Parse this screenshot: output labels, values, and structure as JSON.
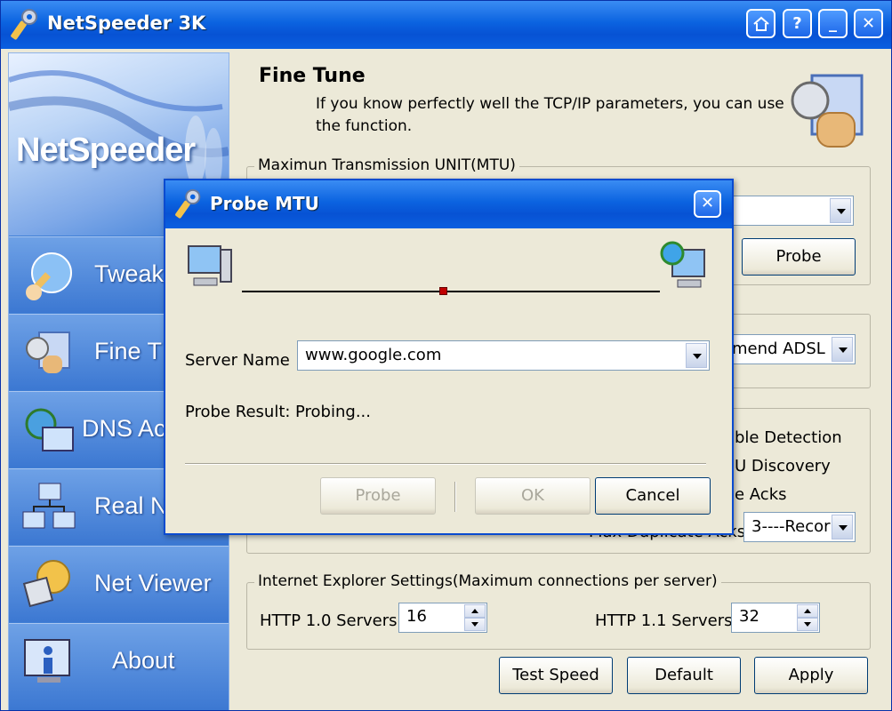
{
  "app": {
    "title": "NetSpeeder 3K",
    "title_buttons": [
      "home-icon",
      "help-icon",
      "minimize-icon",
      "close-icon"
    ]
  },
  "sidebar": {
    "logo_text": "NetSpeeder",
    "items": [
      {
        "label": "Tweak W",
        "icon": "tweak-wizard-icon"
      },
      {
        "label": "Fine T",
        "icon": "fine-tune-icon"
      },
      {
        "label": "DNS Acce",
        "icon": "dns-accelerator-icon"
      },
      {
        "label": "Real N",
        "icon": "network-icon"
      },
      {
        "label": "Net Viewer",
        "icon": "net-viewer-icon"
      },
      {
        "label": "About",
        "icon": "info-icon"
      }
    ]
  },
  "main": {
    "heading": "Fine Tune",
    "description": "If you know perfectly well the TCP/IP parameters, you can use the function.",
    "mtu_group": {
      "label": "Maximun Transmission UNIT(MTU)",
      "probe_button": "Probe"
    },
    "connection_combo": "mend ADSL",
    "options": {
      "opt1": "ble Detection",
      "opt2": "U Discovery",
      "opt3": "e Acks",
      "max_dup_label": "Max Duplicate Acks",
      "max_dup_value": "3----Recor"
    },
    "ie_group": {
      "label": "Internet Explorer Settings(Maximum connections per server)",
      "http10_label": "HTTP 1.0 Servers",
      "http10_value": "16",
      "http11_label": "HTTP 1.1 Servers",
      "http11_value": "32"
    },
    "buttons": {
      "test_speed": "Test Speed",
      "default": "Default",
      "apply": "Apply"
    }
  },
  "dialog": {
    "title": "Probe MTU",
    "progress": 0.48,
    "server_name_label": "Server Name",
    "server_name_value": "www.google.com",
    "probe_result_label": "Probe Result:",
    "probe_result_value": "Probing...",
    "buttons": {
      "probe": "Probe",
      "ok": "OK",
      "cancel": "Cancel"
    }
  },
  "colors": {
    "titlebar": "#0b63e0",
    "sidebar": "#3f7fd6",
    "window_bg": "#ece9d8",
    "marker": "#c00000"
  }
}
